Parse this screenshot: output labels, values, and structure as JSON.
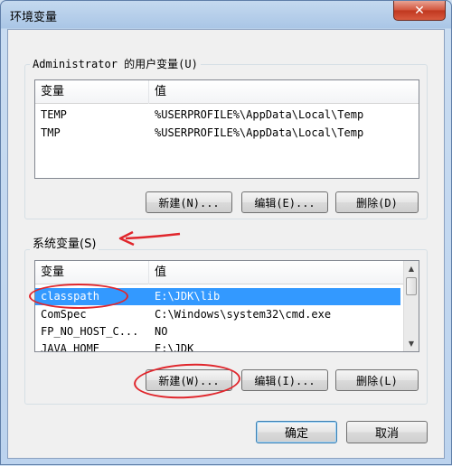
{
  "window": {
    "title": "环境变量",
    "close_glyph": "✕"
  },
  "user_vars": {
    "group_label": "Administrator 的用户变量(U)",
    "columns": [
      "变量",
      "值"
    ],
    "rows": [
      {
        "name": "TEMP",
        "value": "%USERPROFILE%\\AppData\\Local\\Temp"
      },
      {
        "name": "TMP",
        "value": "%USERPROFILE%\\AppData\\Local\\Temp"
      }
    ],
    "buttons": {
      "new": "新建(N)...",
      "edit": "编辑(E)...",
      "delete": "删除(D)"
    }
  },
  "system_vars": {
    "group_label": "系统变量(S)",
    "columns": [
      "变量",
      "值"
    ],
    "rows": [
      {
        "name": "classpath",
        "value": "E:\\JDK\\lib",
        "selected": true
      },
      {
        "name": "ComSpec",
        "value": "C:\\Windows\\system32\\cmd.exe"
      },
      {
        "name": "FP_NO_HOST_C...",
        "value": "NO"
      },
      {
        "name": "JAVA_HOME",
        "value": "E:\\JDK"
      }
    ],
    "buttons": {
      "new": "新建(W)...",
      "edit": "编辑(I)...",
      "delete": "删除(L)"
    }
  },
  "footer": {
    "ok": "确定",
    "cancel": "取消"
  },
  "colors": {
    "selection": "#3399ff",
    "annotation": "#e0262c"
  }
}
